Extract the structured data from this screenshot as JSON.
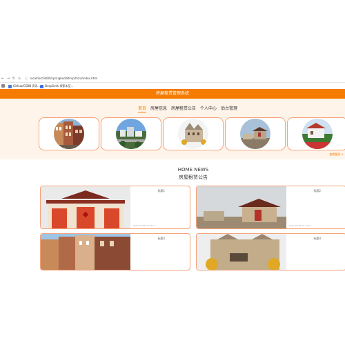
{
  "browser": {
    "url": "localhost:8080/springboot8hrsp/front/index.html",
    "bookmarks": [
      "Github/CSDN 资讯...",
      "DeepSeek 探索未至..."
    ]
  },
  "header": {
    "title": "房屋租赁管理系统"
  },
  "menu": {
    "items": [
      "首页",
      "房屋信息",
      "房屋租赁公告",
      "个人中心",
      "后台管理"
    ],
    "active": "首页"
  },
  "carousel": {
    "more_label": "查看更多 >"
  },
  "news": {
    "title_en": "HOME NEWS",
    "title_cn": "房屋租赁公告",
    "items": [
      {
        "label": "标题1",
        "date": "2021-03-06 10:13:17"
      },
      {
        "label": "标题2",
        "date": "2021-03-06 10:13:17"
      },
      {
        "label": "标题3",
        "date": ""
      },
      {
        "label": "标题4",
        "date": ""
      }
    ]
  },
  "colors": {
    "brand": "#f57c00",
    "nav_bg": "#fff4e9",
    "card_border": "#f5a27a"
  }
}
